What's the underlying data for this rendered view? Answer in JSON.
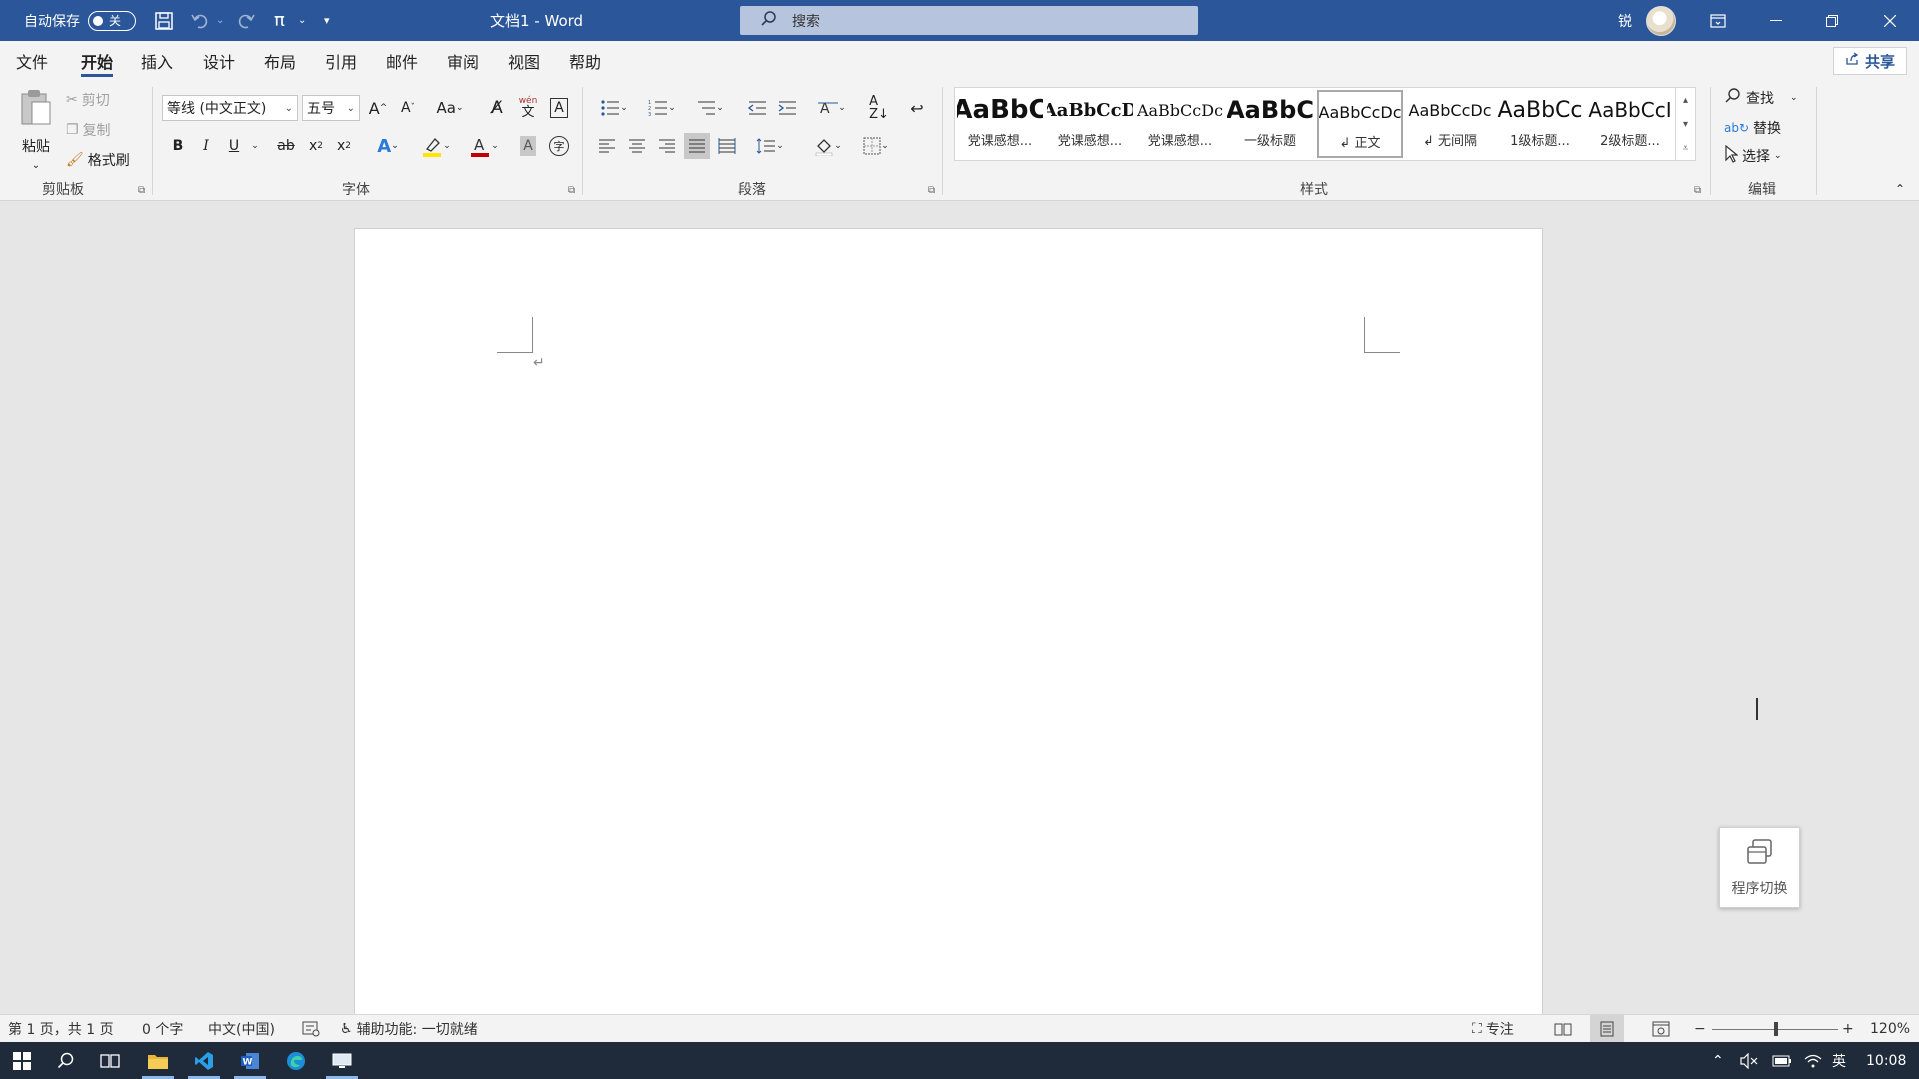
{
  "titlebar": {
    "autosave_label": "自动保存",
    "autosave_state": "关",
    "doc_title": "文档1  -  Word",
    "search_placeholder": "搜索",
    "user_initial": "锐"
  },
  "menu": {
    "tabs": [
      "文件",
      "开始",
      "插入",
      "设计",
      "布局",
      "引用",
      "邮件",
      "审阅",
      "视图",
      "帮助"
    ],
    "active_tab": "开始",
    "share_label": "共享"
  },
  "ribbon": {
    "clipboard": {
      "group_label": "剪贴板",
      "paste": "粘贴",
      "cut": "剪切",
      "copy": "复制",
      "format_painter": "格式刷"
    },
    "font": {
      "group_label": "字体",
      "font_name": "等线 (中文正文)",
      "font_size": "五号",
      "phonetic": "wén"
    },
    "paragraph": {
      "group_label": "段落"
    },
    "styles": {
      "group_label": "样式",
      "items": [
        {
          "sample": "AaBbC",
          "name": "党课感想..."
        },
        {
          "sample": "AaBbCcD",
          "name": "党课感想..."
        },
        {
          "sample": "AaBbCcDc",
          "name": "党课感想..."
        },
        {
          "sample": "AaBbC",
          "name": "一级标题"
        },
        {
          "sample": "AaBbCcDc",
          "name": "↲ 正文"
        },
        {
          "sample": "AaBbCcDc",
          "name": "↲ 无间隔"
        },
        {
          "sample": "AaBbCc",
          "name": "1级标题..."
        },
        {
          "sample": "AaBbCcI",
          "name": "2级标题..."
        }
      ]
    },
    "editing": {
      "group_label": "编辑",
      "find": "查找",
      "replace": "替换",
      "select": "选择"
    }
  },
  "widget": {
    "label": "程序切换"
  },
  "statusbar": {
    "page": "第 1 页，共 1 页",
    "words": "0 个字",
    "language": "中文(中国)",
    "accessibility": "辅助功能: 一切就绪",
    "focus": "专注",
    "zoom": "120%"
  },
  "taskbar": {
    "time": "10:08",
    "ime": "英"
  },
  "colors": {
    "title_bar": "#2b579a",
    "ribbon_bg": "#f3f3f3",
    "canvas_bg": "#e6e6e6",
    "taskbar": "#1f2a3a"
  }
}
